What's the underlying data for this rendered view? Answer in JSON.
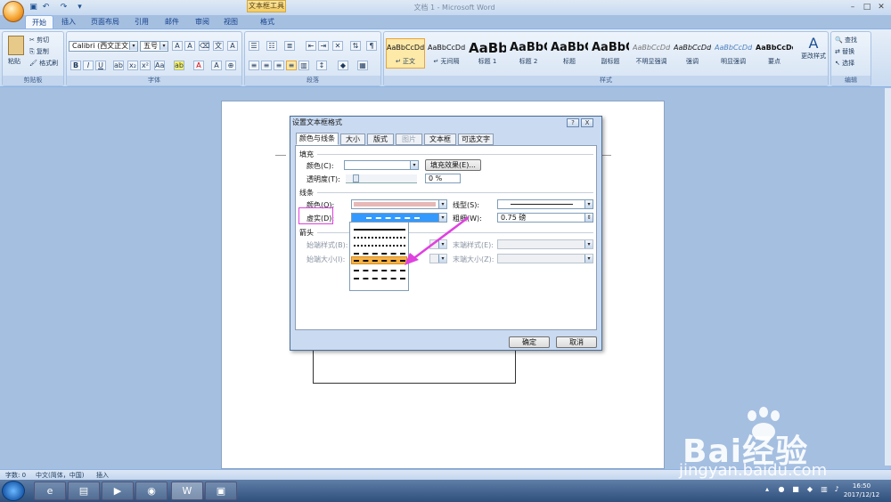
{
  "app": {
    "doc_title": "文档 1 - Microsoft Word",
    "context_tools": "文本框工具",
    "brand_colors": {
      "ribbon": "#c9dbf1",
      "highlight": "#e8a43a",
      "accent_pink": "#e040e0"
    }
  },
  "tabs": [
    "开始",
    "插入",
    "页面布局",
    "引用",
    "邮件",
    "审阅",
    "视图",
    "格式"
  ],
  "clipboard": {
    "paste": "粘贴",
    "cut": "剪切",
    "copy": "复制",
    "format_painter": "格式刷",
    "label": "剪贴板"
  },
  "font": {
    "name": "Calibri (西文正文)",
    "size": "五号",
    "label": "字体"
  },
  "paragraph": {
    "label": "段落"
  },
  "styles": {
    "label": "样式",
    "change_styles": "更改样式",
    "items": [
      {
        "preview": "AaBbCcDd",
        "name": "↵ 正文"
      },
      {
        "preview": "AaBbCcDd",
        "name": "↵ 无间隔"
      },
      {
        "preview": "AaBb",
        "name": "标题 1"
      },
      {
        "preview": "AaBbC",
        "name": "标题 2"
      },
      {
        "preview": "AaBbC",
        "name": "标题"
      },
      {
        "preview": "AaBbC",
        "name": "副标题"
      },
      {
        "preview": "AaBbCcDd",
        "name": "不明显强调"
      },
      {
        "preview": "AaBbCcDd",
        "name": "强调"
      },
      {
        "preview": "AaBbCcDd",
        "name": "明显强调"
      },
      {
        "preview": "AaBbCcDd",
        "name": "要点"
      }
    ]
  },
  "editing": {
    "find": "查找",
    "replace": "替换",
    "select": "选择",
    "label": "编辑"
  },
  "dialog": {
    "title": "设置文本框格式",
    "tabs": [
      "颜色与线条",
      "大小",
      "版式",
      "图片",
      "文本框",
      "可选文字"
    ],
    "fill_section": "填充",
    "fill_color_label": "颜色(C):",
    "fill_effects": "填充效果(E)...",
    "transparency_label": "透明度(T):",
    "transparency_value": "0 %",
    "line_section": "线条",
    "line_color_label": "颜色(O):",
    "line_style_label": "线型(S):",
    "dash_label": "虚实(D):",
    "weight_label": "粗细(W):",
    "weight_value": "0.75 磅",
    "arrows_section": "箭头",
    "begin_style": "始端样式(B):",
    "end_style": "末端样式(E):",
    "begin_size": "始端大小(I):",
    "end_size": "末端大小(Z):",
    "ok": "确定",
    "cancel": "取消",
    "help": "?",
    "close": "X"
  },
  "dash_options": [
    "solid",
    "round-dot",
    "square-dot",
    "dash",
    "dash-dot",
    "long-dash",
    "long-dash-dot"
  ],
  "selected_dash": "long-dash",
  "status": {
    "words": "字数: 0",
    "lang": "中文(简体，中国)",
    "insert": "插入"
  },
  "clock": {
    "time": "16:50",
    "date": "2017/12/12"
  },
  "watermark": {
    "text": "Bai经验",
    "url": "jingyan.baidu.com"
  }
}
